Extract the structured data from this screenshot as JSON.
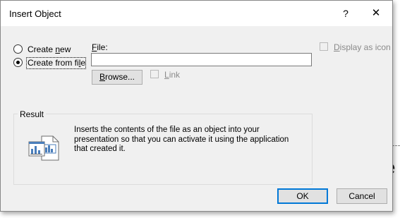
{
  "background": {
    "partial_text": "e"
  },
  "dialog": {
    "title": "Insert Object",
    "help_label": "?",
    "close_label": "✕"
  },
  "radios": {
    "create_new": {
      "label_prefix": "Create ",
      "label_access": "n",
      "label_suffix": "ew",
      "checked": false
    },
    "create_from_file": {
      "label_prefix": "Create from fi",
      "label_access": "l",
      "label_suffix": "e",
      "checked": true
    }
  },
  "file": {
    "label_access": "F",
    "label_suffix": "ile:",
    "value": ""
  },
  "browse_button": {
    "label_access": "B",
    "label_suffix": "rowse..."
  },
  "link_checkbox": {
    "label_access": "L",
    "label_suffix": "ink",
    "checked": false,
    "enabled": false
  },
  "display_as_icon": {
    "label_access": "D",
    "label_suffix": "isplay as icon",
    "checked": false,
    "enabled": false
  },
  "result": {
    "legend": "Result",
    "line1": "Inserts the contents of the file as an object into your",
    "line2": "presentation so that you can activate it using the application",
    "line3": "that created it.",
    "icon": "file-embed-icon"
  },
  "buttons": {
    "ok": "OK",
    "cancel": "Cancel"
  },
  "colors": {
    "dialog_bg": "#f0f0f0",
    "default_button_border": "#0078d7",
    "disabled_text": "#8a8a8a"
  }
}
